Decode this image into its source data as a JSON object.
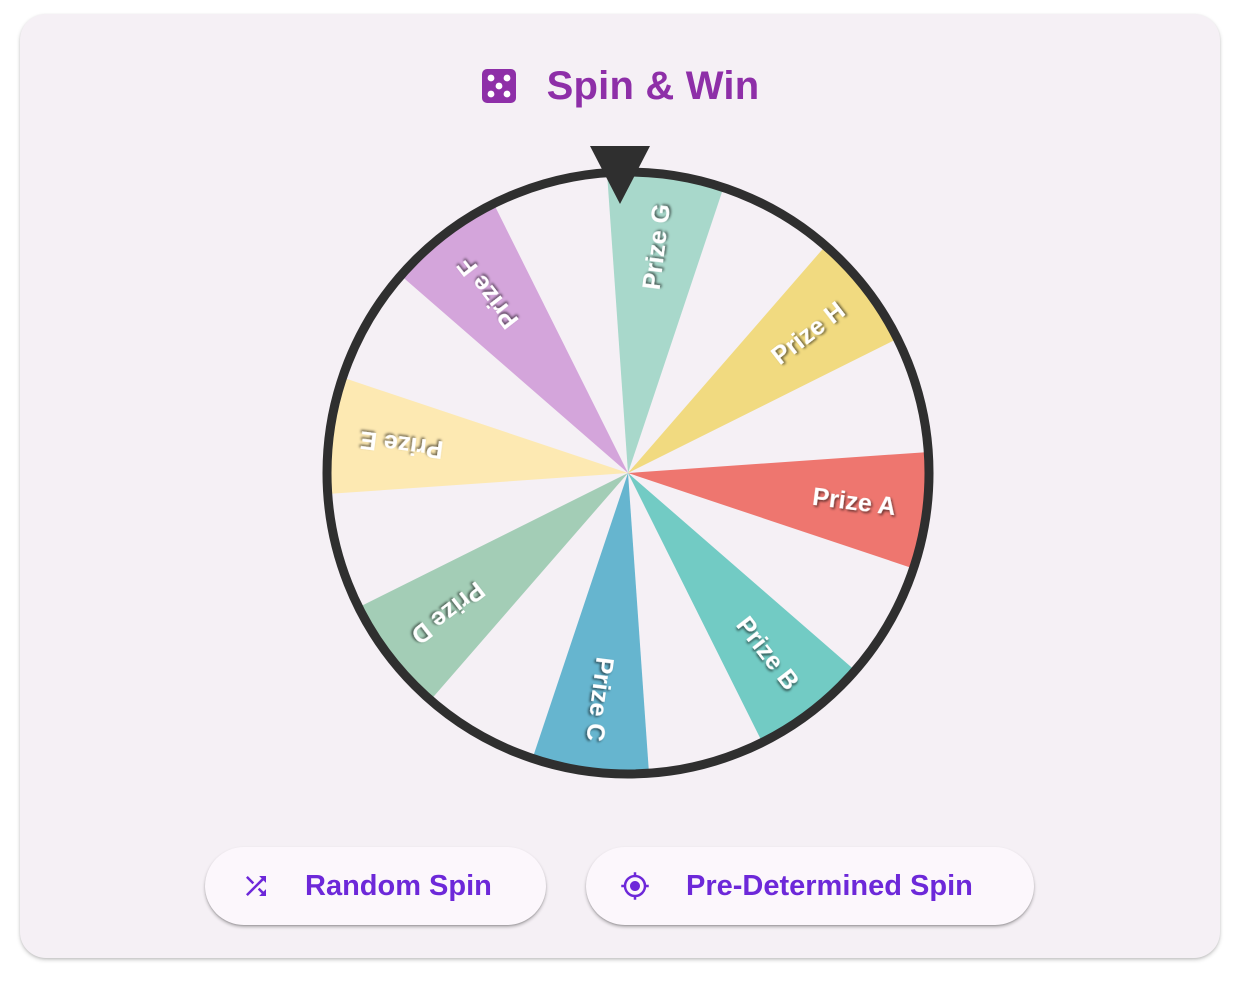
{
  "header": {
    "icon": "dice-icon",
    "title": "Spin & Win",
    "title_color": "#8e2fa8"
  },
  "wheel": {
    "pointer_icon": "pointer-triangle-icon",
    "rim_color": "#2f2f2f",
    "background_color": "#f5f0f5",
    "segments": [
      {
        "label": "Prize A",
        "color": "#ee766f"
      },
      {
        "label": "Prize B",
        "color": "#72cbc4"
      },
      {
        "label": "Prize C",
        "color": "#66b5cf"
      },
      {
        "label": "Prize D",
        "color": "#a3cdb6"
      },
      {
        "label": "Prize E",
        "color": "#fde9b2"
      },
      {
        "label": "Prize F",
        "color": "#d4a5db"
      },
      {
        "label": "Prize G",
        "color": "#a8d8cb"
      },
      {
        "label": "Prize H",
        "color": "#f1da80"
      }
    ]
  },
  "buttons": {
    "random_spin": {
      "label": "Random Spin",
      "icon": "shuffle-icon"
    },
    "predetermined_spin": {
      "label": "Pre-Determined Spin",
      "icon": "crosshair-icon"
    },
    "color": "#6d28d9"
  }
}
